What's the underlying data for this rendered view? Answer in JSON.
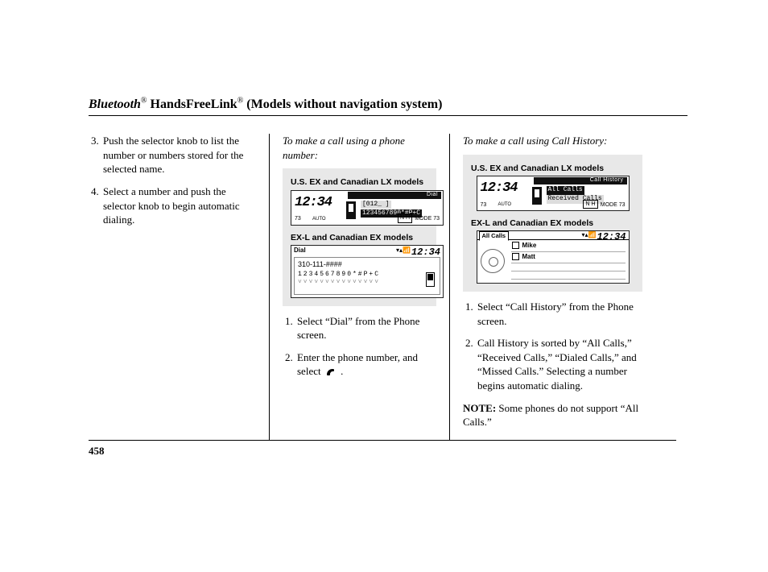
{
  "title": {
    "bluetooth_word": "Bluetooth",
    "reg1": "®",
    "hfl": " HandsFreeLink",
    "reg2": "®",
    "suffix": " (Models without navigation system)"
  },
  "col1": {
    "step3": "Push the selector knob to list the number or numbers stored for the selected name.",
    "step4": "Select a number and push the selector knob to begin automatic dialing."
  },
  "col2": {
    "heading": "To make a call using a phone number:",
    "labelA": "U.S. EX and Canadian LX models",
    "labelB": "EX-L and Canadian EX models",
    "lcdA": {
      "clock": "12:34",
      "bar": "Dial",
      "row1": "[012_         ]",
      "row2": "1234567890*#P+C",
      "tempL": "73",
      "auto": "AUTO",
      "nh": "N H",
      "mode": "MODE  73"
    },
    "lcdB": {
      "hdr": "Dial",
      "clk": "12:34",
      "txt1": "310-111-####",
      "keys": "1234567890*#P+C"
    },
    "step1": "Select “Dial” from the Phone screen.",
    "step2a": "Enter the phone number, and select ",
    "step2b": " ."
  },
  "col3": {
    "heading": "To make a call using Call History:",
    "labelA": "U.S. EX and Canadian LX models",
    "labelB": "EX-L and Canadian EX models",
    "lcdA": {
      "clock": "12:34",
      "bar": "Call History",
      "row1": "All Calls",
      "row2": "Received Calls",
      "tempL": "73",
      "auto": "AUTO",
      "nh": "N H",
      "mode": "MODE  73"
    },
    "lcdB": {
      "tab": "All Calls",
      "clk": "12:34",
      "li1": "Mike",
      "li2": "Matt"
    },
    "step1": "Select “Call History” from the Phone screen.",
    "step2": "Call History is sorted by “All Calls,” “Received Calls,” “Dialed Calls,” and “Missed Calls.” Selecting a number begins automatic dialing.",
    "note_label": "NOTE:",
    "note_text": " Some phones do not support “All Calls.”"
  },
  "page_number": "458"
}
